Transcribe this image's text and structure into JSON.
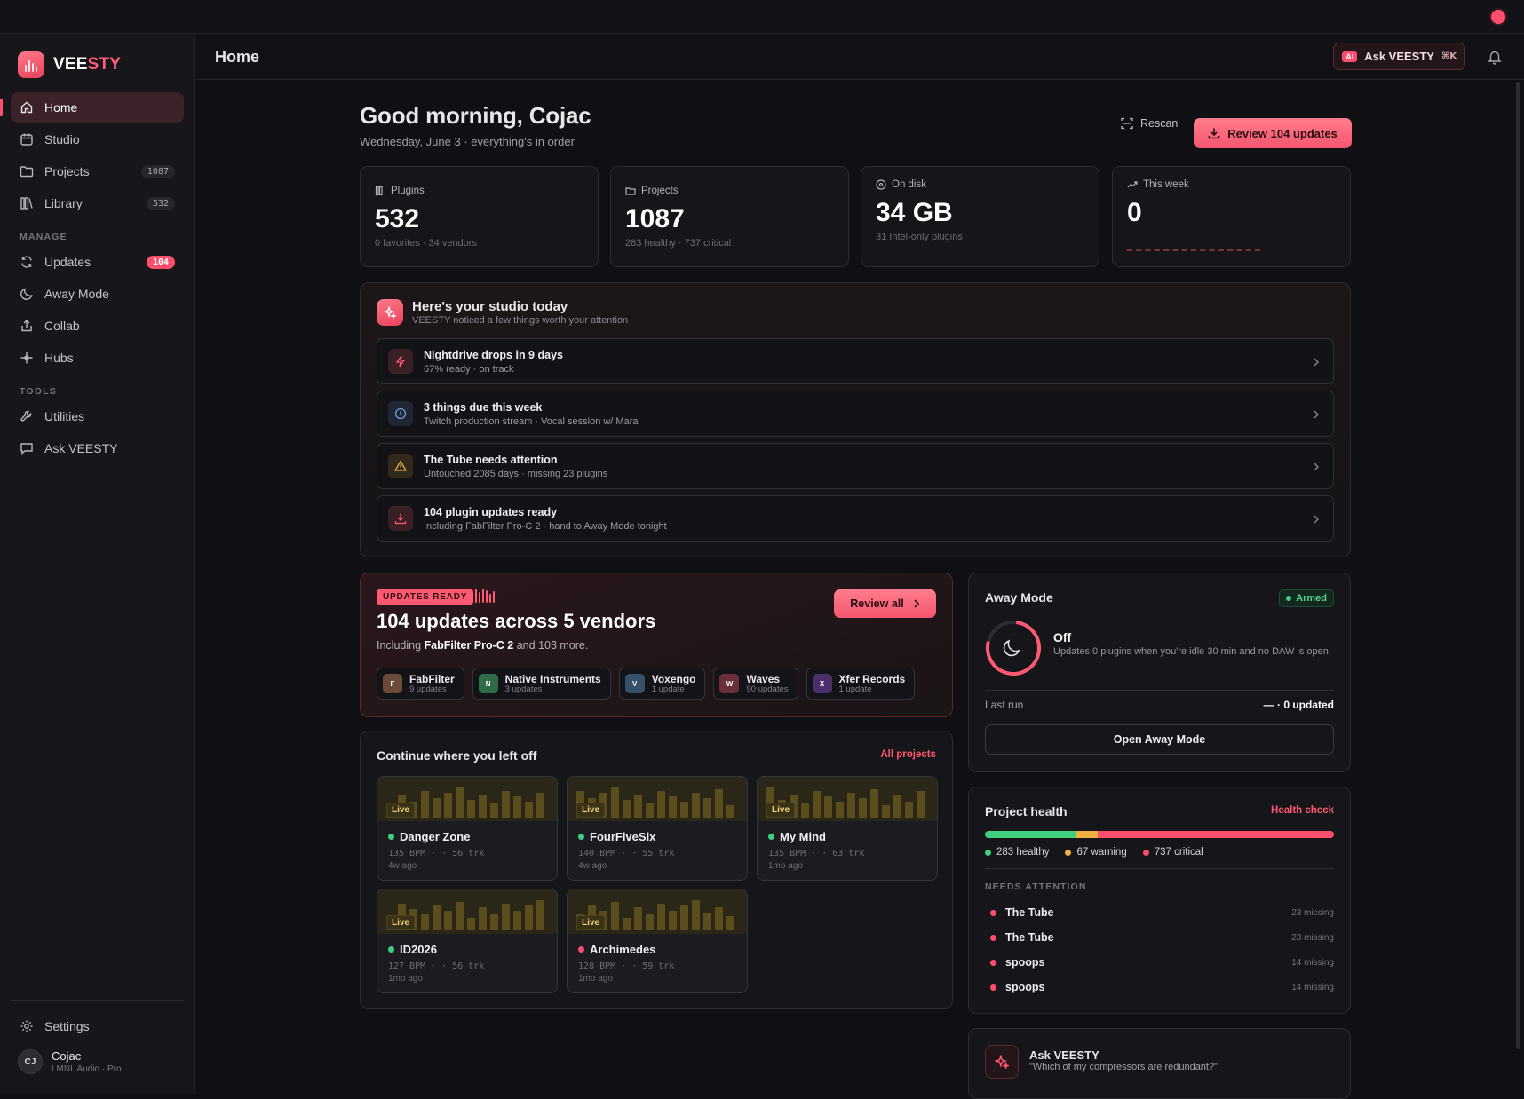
{
  "app": {
    "brand_a": "VEE",
    "brand_b": "STY",
    "page_title": "Home"
  },
  "sidebar": {
    "items": [
      {
        "label": "Home",
        "icon": "home-icon"
      },
      {
        "label": "Studio",
        "icon": "calendar-icon"
      },
      {
        "label": "Projects",
        "icon": "folder-icon",
        "count": "1087"
      },
      {
        "label": "Library",
        "icon": "library-icon",
        "count": "532"
      }
    ],
    "manage_label": "MANAGE",
    "manage": [
      {
        "label": "Updates",
        "icon": "refresh-icon",
        "count": "104"
      },
      {
        "label": "Away Mode",
        "icon": "moon-icon"
      },
      {
        "label": "Collab",
        "icon": "share-icon"
      },
      {
        "label": "Hubs",
        "icon": "hub-icon"
      }
    ],
    "tools_label": "TOOLS",
    "tools": [
      {
        "label": "Utilities",
        "icon": "wrench-icon"
      },
      {
        "label": "Ask VEESTY",
        "icon": "chat-icon"
      }
    ],
    "settings_label": "Settings",
    "user": {
      "initials": "CJ",
      "name": "Cojac",
      "sub": "LMNL Audio · Pro"
    }
  },
  "topbar": {
    "ask_badge": "AI",
    "ask_label": "Ask VEESTY",
    "ask_shortcut": "⌘K"
  },
  "hero": {
    "greeting": "Good morning, Cojac",
    "subtitle": "Wednesday, June 3 · everything's in order",
    "rescan": "Rescan",
    "review": "Review 104 updates"
  },
  "stats": [
    {
      "label": "Plugins",
      "value": "532",
      "sub": "0 favorites · 34 vendors"
    },
    {
      "label": "Projects",
      "value": "1087",
      "sub": "283 healthy · 737 critical"
    },
    {
      "label": "On disk",
      "value": "34 GB",
      "sub": "31 Intel-only plugins"
    },
    {
      "label": "This week",
      "value": "0",
      "sub": ""
    }
  ],
  "insights": {
    "title": "Here's your studio today",
    "subtitle": "VEESTY noticed a few things worth your attention",
    "rows": [
      {
        "title": "Nightdrive drops in 9 days",
        "sub": "67% ready · on track"
      },
      {
        "title": "3 things due this week",
        "sub": "Twitch production stream · Vocal session w/ Mara"
      },
      {
        "title": "The Tube needs attention",
        "sub": "Untouched 2085 days · missing 23 plugins"
      },
      {
        "title": "104 plugin updates ready",
        "sub": "Including FabFilter Pro-C 2 · hand to Away Mode tonight"
      }
    ]
  },
  "updates": {
    "badge": "UPDATES READY",
    "headline": "104 updates across 5 vendors",
    "sub_pre": "Including",
    "sub_bold": "FabFilter Pro-C 2",
    "sub_post": "and 103 more.",
    "review_all": "Review all",
    "vendors": [
      {
        "letter": "F",
        "name": "FabFilter",
        "count": "9 updates",
        "color": "#6b4a3a"
      },
      {
        "letter": "N",
        "name": "Native Instruments",
        "count": "3 updates",
        "color": "#2f6b46"
      },
      {
        "letter": "V",
        "name": "Voxengo",
        "count": "1 update",
        "color": "#35506b"
      },
      {
        "letter": "W",
        "name": "Waves",
        "count": "90 updates",
        "color": "#6b2f3a"
      },
      {
        "letter": "X",
        "name": "Xfer Records",
        "count": "1 update",
        "color": "#4b2f6b"
      }
    ]
  },
  "continue": {
    "title": "Continue where you left off",
    "link": "All projects",
    "live_label": "Live",
    "projects": [
      {
        "name": "Danger Zone",
        "meta": "135 BPM · · 56 trk",
        "ago": "4w ago",
        "status_color": "#3fcf7f"
      },
      {
        "name": "FourFiveSix",
        "meta": "140 BPM · · 55 trk",
        "ago": "4w ago",
        "status_color": "#3fcf7f"
      },
      {
        "name": "My Mind",
        "meta": "135 BPM · · 63 trk",
        "ago": "1mo ago",
        "status_color": "#3fcf7f"
      },
      {
        "name": "ID2026",
        "meta": "127 BPM · · 56 trk",
        "ago": "1mo ago",
        "status_color": "#3fcf7f"
      },
      {
        "name": "Archimedes",
        "meta": "128 BPM · · 59 trk",
        "ago": "1mo ago",
        "status_color": "#ff4d6d"
      }
    ]
  },
  "away": {
    "title": "Away Mode",
    "status_badge": "Armed",
    "state": "Off",
    "desc": "Updates 0 plugins when you're idle 30 min and no DAW is open.",
    "last_run_label": "Last run",
    "last_run_value": "— · 0 updated",
    "open": "Open Away Mode"
  },
  "health": {
    "title": "Project health",
    "link": "Health check",
    "healthy": 283,
    "warning": 67,
    "critical": 737,
    "healthy_label": "283 healthy",
    "warning_label": "67 warning",
    "critical_label": "737 critical",
    "colors": {
      "healthy": "#3fcf7f",
      "warning": "#f0b040",
      "critical": "#ff4d6d"
    },
    "needs_label": "NEEDS ATTENTION",
    "attention": [
      {
        "name": "The Tube",
        "missing": "23 missing"
      },
      {
        "name": "The Tube",
        "missing": "23 missing"
      },
      {
        "name": "spoops",
        "missing": "14 missing"
      },
      {
        "name": "spoops",
        "missing": "14 missing"
      }
    ]
  },
  "ask": {
    "title": "Ask VEESTY",
    "prompt": "\"Which of my compressors are redundant?\""
  },
  "colors": {
    "accent": "#ff4d6d",
    "background": "#101014"
  }
}
